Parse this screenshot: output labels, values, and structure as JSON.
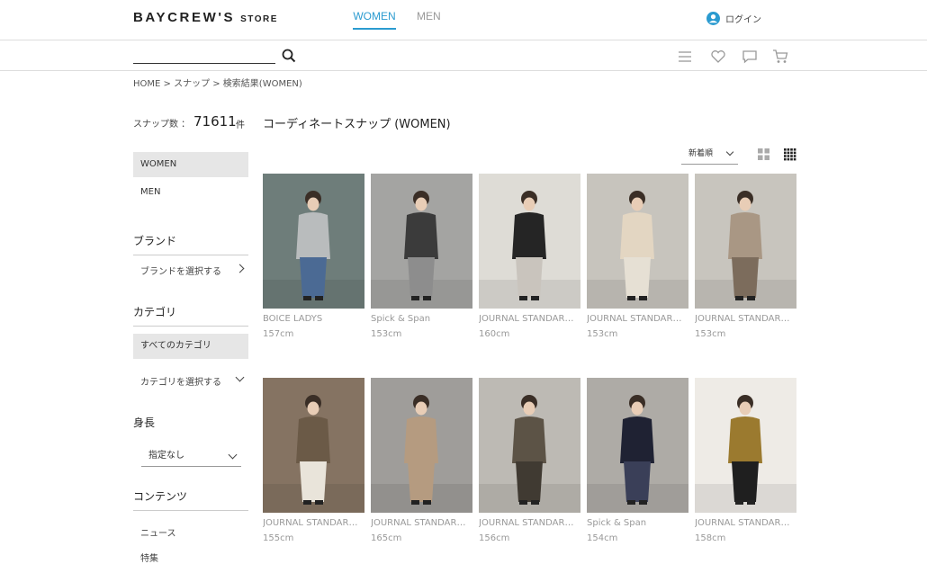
{
  "header": {
    "logo_main": "BAYCREW'S",
    "logo_sub": "STORE",
    "tabs": [
      "WOMEN",
      "MEN"
    ],
    "login_label": "ログイン"
  },
  "search": {
    "placeholder": ""
  },
  "breadcrumb": "HOME > スナップ > 検索結果(WOMEN)",
  "sidebar": {
    "count_label": "スナップ数 ：",
    "count_value": "71611",
    "count_unit": "件",
    "gender_items": [
      "WOMEN",
      "MEN"
    ],
    "brand_heading": "ブランド",
    "brand_select": "ブランドを選択する",
    "category_heading": "カテゴリ",
    "category_all": "すべてのカテゴリ",
    "category_select": "カテゴリを選択する",
    "height_heading": "身長",
    "height_select": "指定なし",
    "contents_heading": "コンテンツ",
    "contents_items": [
      "ニュース",
      "特集"
    ]
  },
  "main": {
    "title": "コーディネートスナップ (WOMEN)",
    "sort_label": "新着順"
  },
  "snaps": [
    {
      "brand": "BOICE LADYS",
      "height": "157cm",
      "bg": "#6e7d7a",
      "coat": "#b9bcbd",
      "bottom": "#4b6a94"
    },
    {
      "brand": "Spick & Span",
      "height": "153cm",
      "bg": "#a4a4a2",
      "coat": "#3b3b3b",
      "bottom": "#8d8d8d"
    },
    {
      "brand": "JOURNAL STANDARD relume",
      "height": "160cm",
      "bg": "#dedcd6",
      "coat": "#252525",
      "bottom": "#c9c4bd"
    },
    {
      "brand": "JOURNAL STANDARD relume",
      "height": "153cm",
      "bg": "#c7c4bd",
      "coat": "#e3d6c2",
      "bottom": "#e6e0d4"
    },
    {
      "brand": "JOURNAL STANDARD relume",
      "height": "153cm",
      "bg": "#c8c5be",
      "coat": "#a99784",
      "bottom": "#7c6c5c"
    },
    {
      "brand": "JOURNAL STANDARD relume",
      "height": "155cm",
      "bg": "#857362",
      "coat": "#6b5a47",
      "bottom": "#e9e4da"
    },
    {
      "brand": "JOURNAL STANDARD relume",
      "height": "165cm",
      "bg": "#9f9d9a",
      "coat": "#b59b80",
      "bottom": "#b59b80"
    },
    {
      "brand": "JOURNAL STANDARD relume",
      "height": "156cm",
      "bg": "#bdbab4",
      "coat": "#5c5346",
      "bottom": "#403a32"
    },
    {
      "brand": "Spick & Span",
      "height": "154cm",
      "bg": "#aeaba6",
      "coat": "#1f2233",
      "bottom": "#3a3f58"
    },
    {
      "brand": "JOURNAL STANDARD relume",
      "height": "158cm",
      "bg": "#eeebe6",
      "coat": "#9b7a2f",
      "bottom": "#1f1f1f"
    }
  ]
}
